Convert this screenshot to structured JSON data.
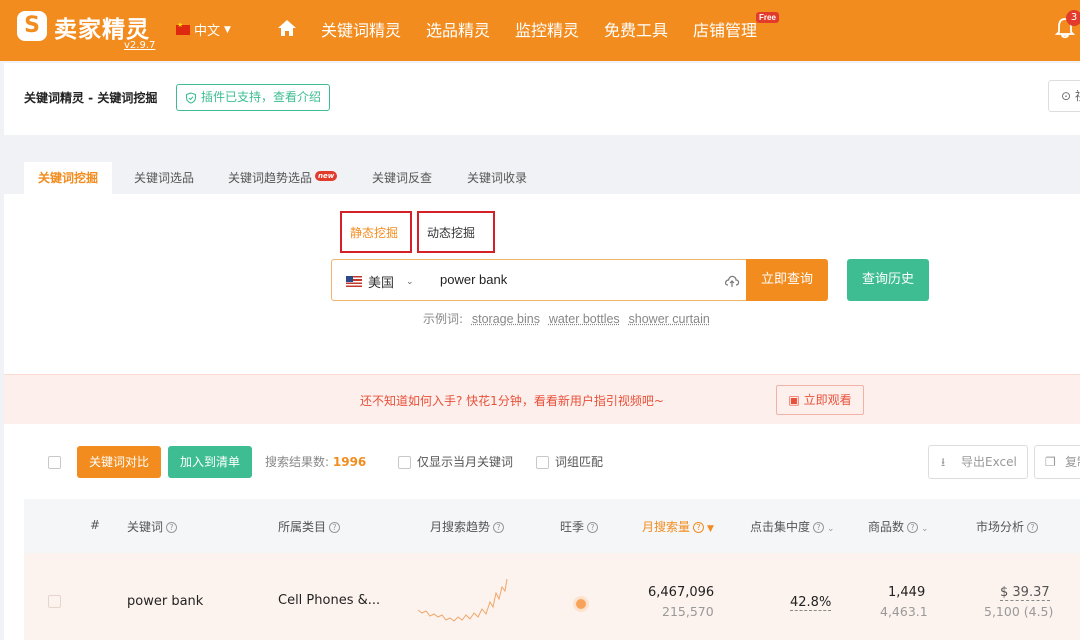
{
  "header": {
    "logo_text": "卖家精灵",
    "logo_mark": "S",
    "version": "v2.9.7",
    "language": "中文",
    "nav": [
      "关键词精灵",
      "选品精灵",
      "监控精灵",
      "免费工具",
      "店铺管理"
    ],
    "free_badge": "Free",
    "notification_count": "3"
  },
  "breadcrumb": {
    "text": "关键词精灵 - 关键词挖掘",
    "plugin_badge": "插件已支持，查看介绍",
    "video_label": "视"
  },
  "tabs": [
    {
      "label": "关键词挖掘"
    },
    {
      "label": "关键词选品"
    },
    {
      "label": "关键词趋势选品"
    },
    {
      "label": "关键词反查"
    },
    {
      "label": "关键词收录"
    }
  ],
  "new_badge": "new",
  "modes": {
    "static": "静态挖掘",
    "dynamic": "动态挖掘"
  },
  "search": {
    "country": "美国",
    "query": "power bank",
    "submit": "立即查询",
    "history": "查询历史"
  },
  "examples": {
    "label": "示例词:",
    "items": [
      "storage bins",
      "water bottles",
      "shower curtain"
    ]
  },
  "banner": {
    "text": "还不知道如何入手? 快花1分钟，看看新用户指引视频吧~",
    "button": "立即观看"
  },
  "toolbar": {
    "compare": "关键词对比",
    "add_list": "加入到清单",
    "result_label": "搜索结果数:",
    "result_count": "1996",
    "only_current_month": "仅显示当月关键词",
    "phrase_match": "词组匹配",
    "export": "导出Excel",
    "copy": "复制"
  },
  "table": {
    "headers": [
      "#",
      "关键词",
      "所属类目",
      "月搜索趋势",
      "旺季",
      "月搜索量",
      "点击集中度",
      "商品数",
      "市场分析"
    ],
    "rows": [
      {
        "keyword": "power bank",
        "category": "Cell Phones &...",
        "monthly_searches": "6,467,096",
        "daily_searches": "215,570",
        "click_concentration": "42.8%",
        "products": "1,449",
        "products_sub": "4,463.1",
        "price": "$ 39.37",
        "reviews": "5,100 (4.5)"
      }
    ]
  },
  "colors": {
    "brand_orange": "#f28c1e",
    "green": "#3ebd93",
    "red_highlight": "#d32029"
  }
}
